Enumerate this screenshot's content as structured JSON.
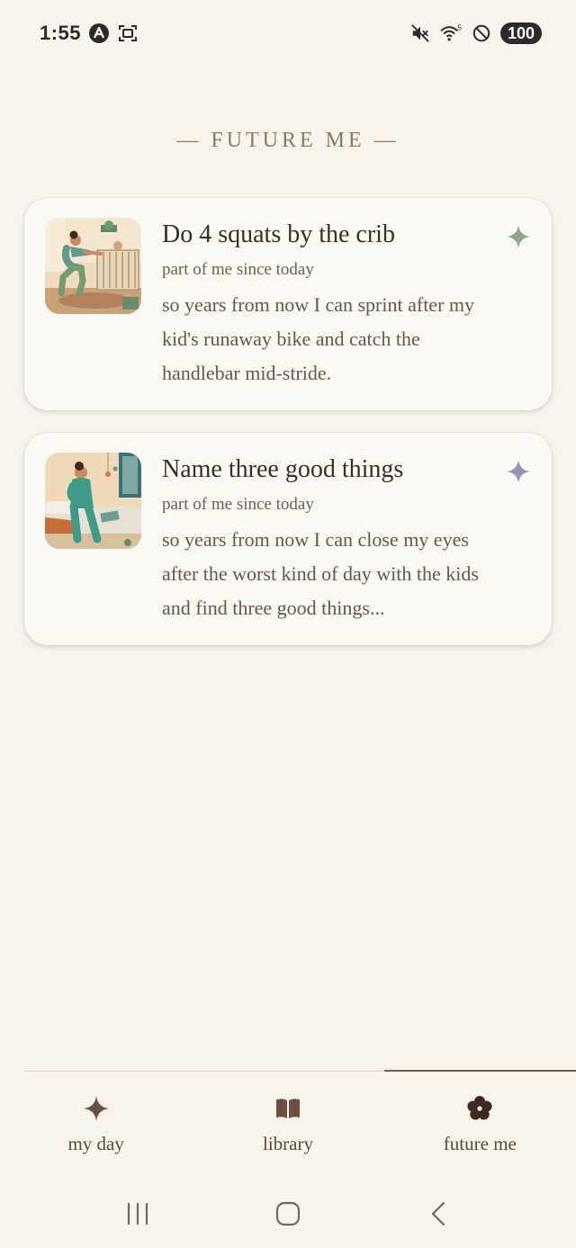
{
  "status_bar": {
    "time": "1:55",
    "wifi_label": "5",
    "battery": "100"
  },
  "header": {
    "title": "— FUTURE ME —"
  },
  "cards": [
    {
      "title": "Do 4 squats by the crib",
      "since": "part of me since today",
      "body": "so years from now I can sprint after my kid's runaway bike and catch the handlebar mid-stride.",
      "sparkle_color": "#8fa893"
    },
    {
      "title": "Name three good things",
      "since": "part of me since today",
      "body": "so years from now I can close my eyes after the worst kind of day with the kids and find three good things...",
      "sparkle_color": "#9a93b8"
    }
  ],
  "nav": {
    "items": [
      {
        "label": "my day",
        "icon": "sparkle-icon"
      },
      {
        "label": "library",
        "icon": "book-icon"
      },
      {
        "label": "future me",
        "icon": "flower-icon"
      }
    ],
    "active": "future me"
  },
  "colors": {
    "background": "#f8f4ec",
    "card": "#fbf9f4",
    "text_dark": "#3a2e26",
    "nav_icon": "#6e5040"
  }
}
